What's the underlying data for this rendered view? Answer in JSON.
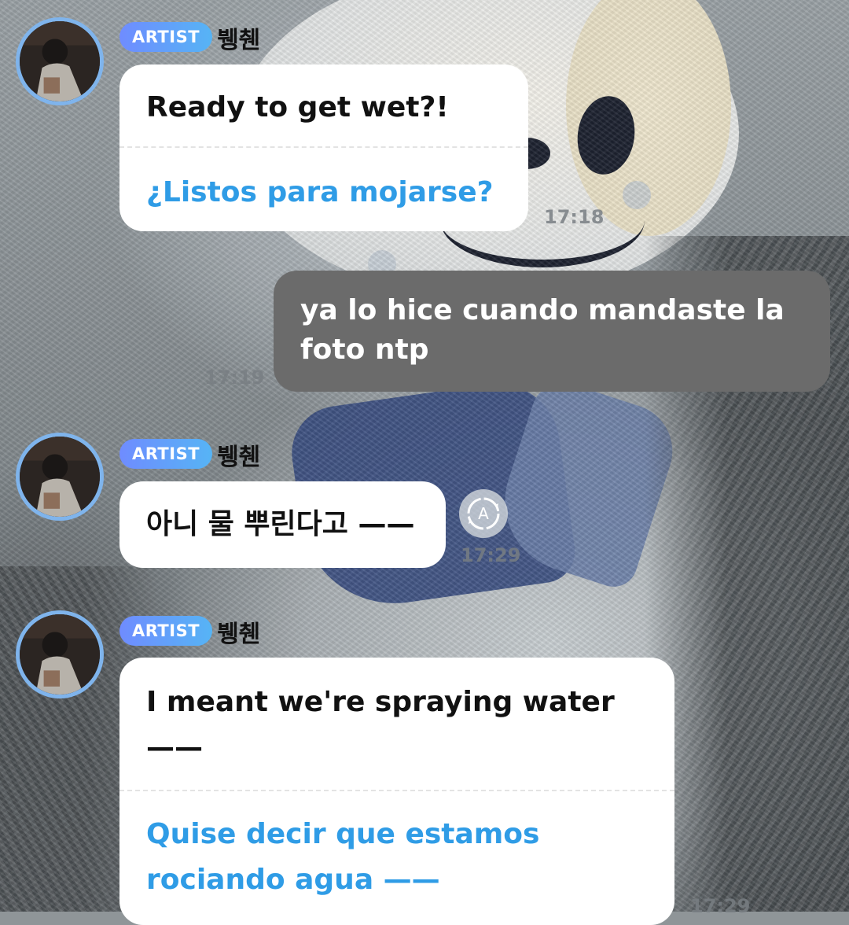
{
  "chat": {
    "artist_badge": "ARTIST",
    "artist_name": "뷍췐",
    "messages": [
      {
        "type": "artist",
        "text": "Ready to get wet?!",
        "translation": "¿Listos para mojarse?",
        "time": "17:18"
      },
      {
        "type": "mine",
        "text": "ya lo hice cuando mandaste la foto ntp",
        "time": "17:19"
      },
      {
        "type": "artist",
        "text": "아니 물 뿌린다고 ——",
        "translate_icon": "auto-translate-icon",
        "translate_icon_letter": "A",
        "time": "17:29"
      },
      {
        "type": "artist",
        "text": "I meant we're spraying water ——",
        "translation": "Quise decir que estamos rociando agua ——",
        "time": "17:29"
      }
    ]
  },
  "colors": {
    "badge_start": "#6f8cff",
    "badge_end": "#56b4f5",
    "translation_text": "#2f9ce6",
    "my_bubble": "#6b6b6b",
    "avatar_ring": "#7fb4ec"
  }
}
